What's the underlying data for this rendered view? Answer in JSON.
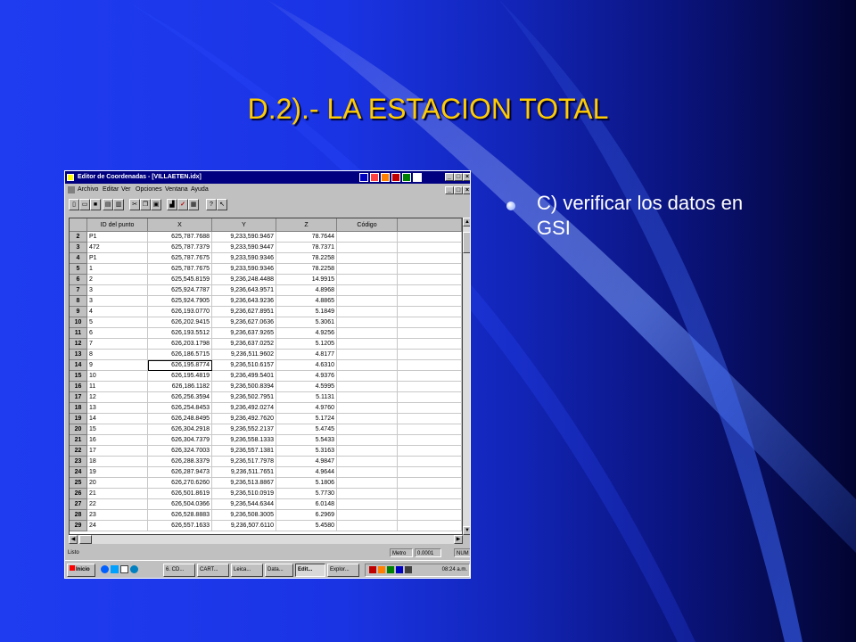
{
  "slide": {
    "title": "D.2).- LA ESTACION TOTAL",
    "bullet": "C) verificar los datos en GSI"
  },
  "window": {
    "title": "Editor de Coordenadas - [VILLAETEN.idx]",
    "menu": [
      "Archivo",
      "Editar",
      "Ver",
      "Opciones",
      "Ventana",
      "Ayuda"
    ],
    "toolbar_icons": [
      "new-file-icon",
      "open-folder-icon",
      "save-icon",
      "print-preview-icon",
      "print-icon",
      "cut-icon",
      "copy-icon",
      "paste-icon",
      "chart-icon",
      "check-icon",
      "grid-icon",
      "help-icon",
      "help-pointer-icon"
    ],
    "columns": [
      "ID del punto",
      "X",
      "Y",
      "Z",
      "Código"
    ],
    "rows": [
      {
        "n": "2",
        "id": "P1",
        "x": "625,787.7688",
        "y": "9,233,590.9467",
        "z": "78.7644",
        "c": ""
      },
      {
        "n": "3",
        "id": "472",
        "x": "625,787.7379",
        "y": "9,233,590.9447",
        "z": "78.7371",
        "c": ""
      },
      {
        "n": "4",
        "id": "P1",
        "x": "625,787.7675",
        "y": "9,233,590.9346",
        "z": "78.2258",
        "c": ""
      },
      {
        "n": "5",
        "id": "1",
        "x": "625,787.7675",
        "y": "9,233,590.9346",
        "z": "78.2258",
        "c": ""
      },
      {
        "n": "6",
        "id": "2",
        "x": "625,545.8159",
        "y": "9,236,248.4488",
        "z": "14.9915",
        "c": ""
      },
      {
        "n": "7",
        "id": "3",
        "x": "625,924.7787",
        "y": "9,236,643.9571",
        "z": "4.8968",
        "c": ""
      },
      {
        "n": "8",
        "id": "3",
        "x": "625,924.7905",
        "y": "9,236,643.9236",
        "z": "4.8865",
        "c": ""
      },
      {
        "n": "9",
        "id": "4",
        "x": "626,193.0770",
        "y": "9,236,627.8951",
        "z": "5.1849",
        "c": ""
      },
      {
        "n": "10",
        "id": "5",
        "x": "626,202.9415",
        "y": "9,236,627.0636",
        "z": "5.3061",
        "c": ""
      },
      {
        "n": "11",
        "id": "6",
        "x": "626,193.5512",
        "y": "9,236,637.9265",
        "z": "4.9256",
        "c": ""
      },
      {
        "n": "12",
        "id": "7",
        "x": "626,203.1798",
        "y": "9,236,637.0252",
        "z": "5.1205",
        "c": ""
      },
      {
        "n": "13",
        "id": "8",
        "x": "626,186.5715",
        "y": "9,236,511.9602",
        "z": "4.8177",
        "c": ""
      },
      {
        "n": "14",
        "id": "9",
        "x": "626,195.8774",
        "y": "9,236,510.6157",
        "z": "4.6310",
        "c": ""
      },
      {
        "n": "15",
        "id": "10",
        "x": "626,195.4819",
        "y": "9,236,499.5401",
        "z": "4.9376",
        "c": ""
      },
      {
        "n": "16",
        "id": "11",
        "x": "626,186.1182",
        "y": "9,236,500.8394",
        "z": "4.5995",
        "c": ""
      },
      {
        "n": "17",
        "id": "12",
        "x": "626,256.3594",
        "y": "9,236,502.7951",
        "z": "5.1131",
        "c": ""
      },
      {
        "n": "18",
        "id": "13",
        "x": "626,254.8453",
        "y": "9,236,492.0274",
        "z": "4.9760",
        "c": ""
      },
      {
        "n": "19",
        "id": "14",
        "x": "626,248.8495",
        "y": "9,236,492.7620",
        "z": "5.1724",
        "c": ""
      },
      {
        "n": "20",
        "id": "15",
        "x": "626,304.2918",
        "y": "9,236,552.2137",
        "z": "5.4745",
        "c": ""
      },
      {
        "n": "21",
        "id": "16",
        "x": "626,304.7379",
        "y": "9,236,558.1333",
        "z": "5.5433",
        "c": ""
      },
      {
        "n": "22",
        "id": "17",
        "x": "626,324.7003",
        "y": "9,236,557.1381",
        "z": "5.3163",
        "c": ""
      },
      {
        "n": "23",
        "id": "18",
        "x": "626,288.3379",
        "y": "9,236,517.7978",
        "z": "4.9847",
        "c": ""
      },
      {
        "n": "24",
        "id": "19",
        "x": "626,287.9473",
        "y": "9,236,511.7651",
        "z": "4.9644",
        "c": ""
      },
      {
        "n": "25",
        "id": "20",
        "x": "626,270.6260",
        "y": "9,236,513.8867",
        "z": "5.1806",
        "c": ""
      },
      {
        "n": "26",
        "id": "21",
        "x": "626,501.8619",
        "y": "9,236,510.0919",
        "z": "5.7730",
        "c": ""
      },
      {
        "n": "27",
        "id": "22",
        "x": "626,504.0366",
        "y": "9,236,544.6344",
        "z": "6.0148",
        "c": ""
      },
      {
        "n": "28",
        "id": "23",
        "x": "626,528.8883",
        "y": "9,236,508.3005",
        "z": "6.2969",
        "c": ""
      },
      {
        "n": "29",
        "id": "24",
        "x": "626,557.1633",
        "y": "9,236,507.6110",
        "z": "5.4580",
        "c": ""
      }
    ],
    "selected_row": "14",
    "status": {
      "ready": "Listo",
      "unit": "Metro",
      "precision": "0.0001",
      "mode": "NUM"
    },
    "taskbar": {
      "start": "Inicio",
      "tasks": [
        "6. CD...",
        "CART...",
        "Leica...",
        "Data...",
        "Edit...",
        "Explor..."
      ],
      "active_task": "Edit...",
      "clock": "08:24 a.m."
    }
  },
  "colors": {
    "title": "#ffcc00",
    "titlebar": "#000080",
    "background": "#1f3cf0"
  }
}
